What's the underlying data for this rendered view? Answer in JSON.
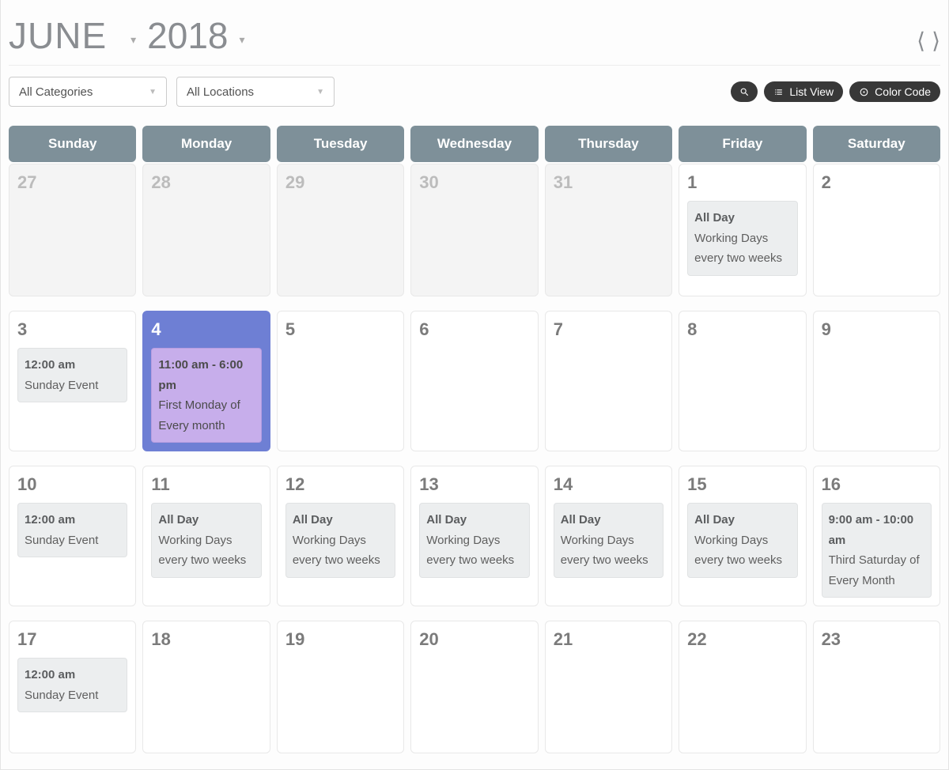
{
  "header": {
    "month": "JUNE",
    "year": "2018"
  },
  "filters": {
    "categories": "All Categories",
    "locations": "All Locations"
  },
  "toolbar": {
    "list_view": "List View",
    "color_code": "Color Code"
  },
  "day_names": [
    "Sunday",
    "Monday",
    "Tuesday",
    "Wednesday",
    "Thursday",
    "Friday",
    "Saturday"
  ],
  "weeks": [
    {
      "cells": [
        {
          "num": "27",
          "out": true,
          "events": []
        },
        {
          "num": "28",
          "out": true,
          "events": []
        },
        {
          "num": "29",
          "out": true,
          "events": []
        },
        {
          "num": "30",
          "out": true,
          "events": []
        },
        {
          "num": "31",
          "out": true,
          "events": []
        },
        {
          "num": "1",
          "events": [
            {
              "time": "All Day",
              "title": "Working Days every two weeks"
            }
          ]
        },
        {
          "num": "2",
          "events": []
        }
      ]
    },
    {
      "cells": [
        {
          "num": "3",
          "events": [
            {
              "time": "12:00 am",
              "title": "Sunday Event"
            }
          ]
        },
        {
          "num": "4",
          "highlight": true,
          "events": [
            {
              "time": "11:00 am - 6:00 pm",
              "title": "First Monday of Every month",
              "style": "purple"
            }
          ]
        },
        {
          "num": "5",
          "events": []
        },
        {
          "num": "6",
          "events": []
        },
        {
          "num": "7",
          "events": []
        },
        {
          "num": "8",
          "events": []
        },
        {
          "num": "9",
          "events": []
        }
      ]
    },
    {
      "cells": [
        {
          "num": "10",
          "events": [
            {
              "time": "12:00 am",
              "title": "Sunday Event"
            }
          ]
        },
        {
          "num": "11",
          "events": [
            {
              "time": "All Day",
              "title": "Working Days every two weeks"
            }
          ]
        },
        {
          "num": "12",
          "events": [
            {
              "time": "All Day",
              "title": "Working Days every two weeks"
            }
          ]
        },
        {
          "num": "13",
          "events": [
            {
              "time": "All Day",
              "title": "Working Days every two weeks"
            }
          ]
        },
        {
          "num": "14",
          "events": [
            {
              "time": "All Day",
              "title": "Working Days every two weeks"
            }
          ]
        },
        {
          "num": "15",
          "events": [
            {
              "time": "All Day",
              "title": "Working Days every two weeks"
            }
          ]
        },
        {
          "num": "16",
          "events": [
            {
              "time": "9:00 am - 10:00 am",
              "title": "Third Saturday of Every Month"
            }
          ]
        }
      ]
    },
    {
      "cells": [
        {
          "num": "17",
          "events": [
            {
              "time": "12:00 am",
              "title": "Sunday Event"
            }
          ]
        },
        {
          "num": "18",
          "events": []
        },
        {
          "num": "19",
          "events": []
        },
        {
          "num": "20",
          "events": []
        },
        {
          "num": "21",
          "events": []
        },
        {
          "num": "22",
          "events": []
        },
        {
          "num": "23",
          "events": []
        }
      ]
    }
  ]
}
